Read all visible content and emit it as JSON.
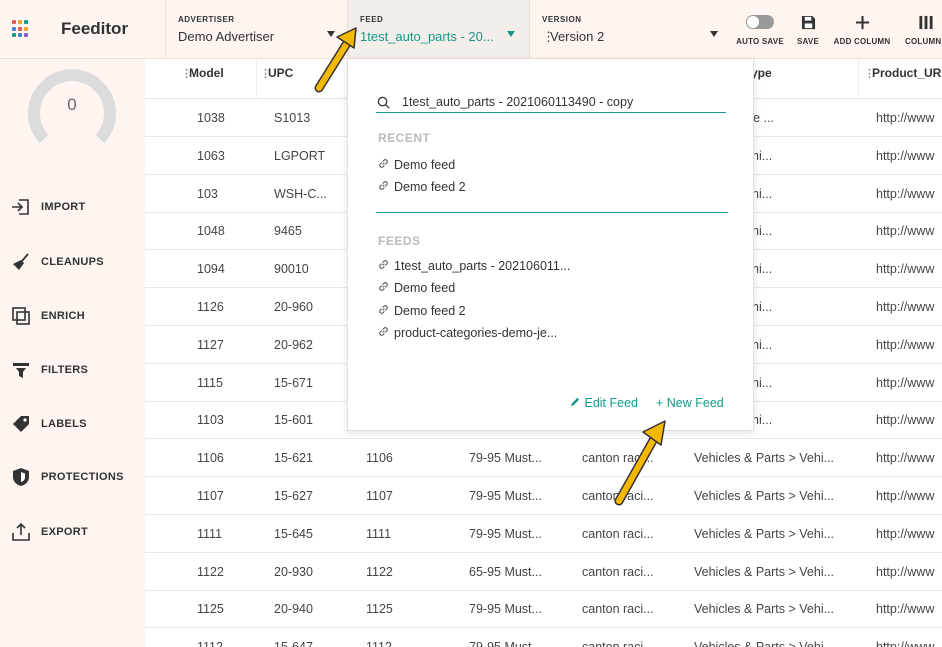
{
  "app": {
    "name": "Feeditor"
  },
  "header": {
    "advertiser": {
      "caption": "ADVERTISER",
      "value": "Demo Advertiser"
    },
    "feed": {
      "caption": "FEED",
      "value": "1test_auto_parts - 20..."
    },
    "version": {
      "caption": "VERSION",
      "value": "Version 2"
    },
    "tools": {
      "auto_save": "AUTO SAVE",
      "save": "SAVE",
      "add_column": "ADD COLUMN",
      "column": "COLUMN"
    }
  },
  "sidebar": {
    "gauge_value": "0",
    "items": [
      {
        "label": "IMPORT",
        "icon": "import-icon"
      },
      {
        "label": "CLEANUPS",
        "icon": "broom-icon"
      },
      {
        "label": "ENRICH",
        "icon": "enrich-icon"
      },
      {
        "label": "FILTERS",
        "icon": "filter-icon"
      },
      {
        "label": "LABELS",
        "icon": "label-icon"
      },
      {
        "label": "PROTECTIONS",
        "icon": "shield-icon"
      },
      {
        "label": "EXPORT",
        "icon": "export-icon"
      }
    ]
  },
  "table": {
    "columns": [
      "Model",
      "UPC",
      "",
      "",
      "",
      "ype",
      "Product_UR"
    ],
    "rows": [
      [
        "1038",
        "S1013",
        "",
        "",
        "",
        "peedo Face ...",
        "http://www"
      ],
      [
        "1063",
        "LGPORT",
        "",
        "",
        "",
        "Parts > Vehi...",
        "http://www"
      ],
      [
        "103",
        "WSH-C...",
        "",
        "",
        "",
        "Parts > Vehi...",
        "http://www"
      ],
      [
        "1048",
        "9465",
        "",
        "",
        "",
        "Parts > Vehi...",
        "http://www"
      ],
      [
        "1094",
        "90010",
        "",
        "",
        "",
        "Parts > Vehi...",
        "http://www"
      ],
      [
        "1126",
        "20-960",
        "",
        "",
        "",
        "Parts > Vehi...",
        "http://www"
      ],
      [
        "1127",
        "20-962",
        "",
        "",
        "",
        "Parts > Vehi...",
        "http://www"
      ],
      [
        "1115",
        "15-671",
        "",
        "",
        "",
        "Parts > Vehi...",
        "http://www"
      ],
      [
        "1103",
        "15-601",
        "",
        "",
        "",
        "Parts > Vehi...",
        "http://www"
      ],
      [
        "1106",
        "15-621",
        "1106",
        "79-95 Must...",
        "canton raci...",
        "Vehicles & Parts > Vehi...",
        "http://www"
      ],
      [
        "1107",
        "15-627",
        "1107",
        "79-95 Must...",
        "canton raci...",
        "Vehicles & Parts > Vehi...",
        "http://www"
      ],
      [
        "1111",
        "15-645",
        "1111",
        "79-95 Must...",
        "canton raci...",
        "Vehicles & Parts > Vehi...",
        "http://www"
      ],
      [
        "1122",
        "20-930",
        "1122",
        "65-95 Must...",
        "canton raci...",
        "Vehicles & Parts > Vehi...",
        "http://www"
      ],
      [
        "1125",
        "20-940",
        "1125",
        "79-95 Must...",
        "canton raci...",
        "Vehicles & Parts > Vehi...",
        "http://www"
      ],
      [
        "1112",
        "15-647",
        "1112",
        "79-95 Must...",
        "canton raci...",
        "Vehicles & Parts > Vehi...",
        "http://www"
      ]
    ]
  },
  "dropdown": {
    "search_value": "1test_auto_parts -  2021060113490 - copy",
    "recent_heading": "RECENT",
    "recent": [
      "Demo feed",
      "Demo feed 2"
    ],
    "feeds_heading": "FEEDS",
    "feeds": [
      "1test_auto_parts - 202106011...",
      "Demo feed",
      "Demo feed 2",
      "product-categories-demo-je..."
    ],
    "edit_feed": "Edit Feed",
    "new_feed": "+ New Feed"
  },
  "colors": {
    "accent": "#13998a",
    "sidebar_bg": "#fff5f0",
    "annotation_arrow": "#f5b800"
  }
}
